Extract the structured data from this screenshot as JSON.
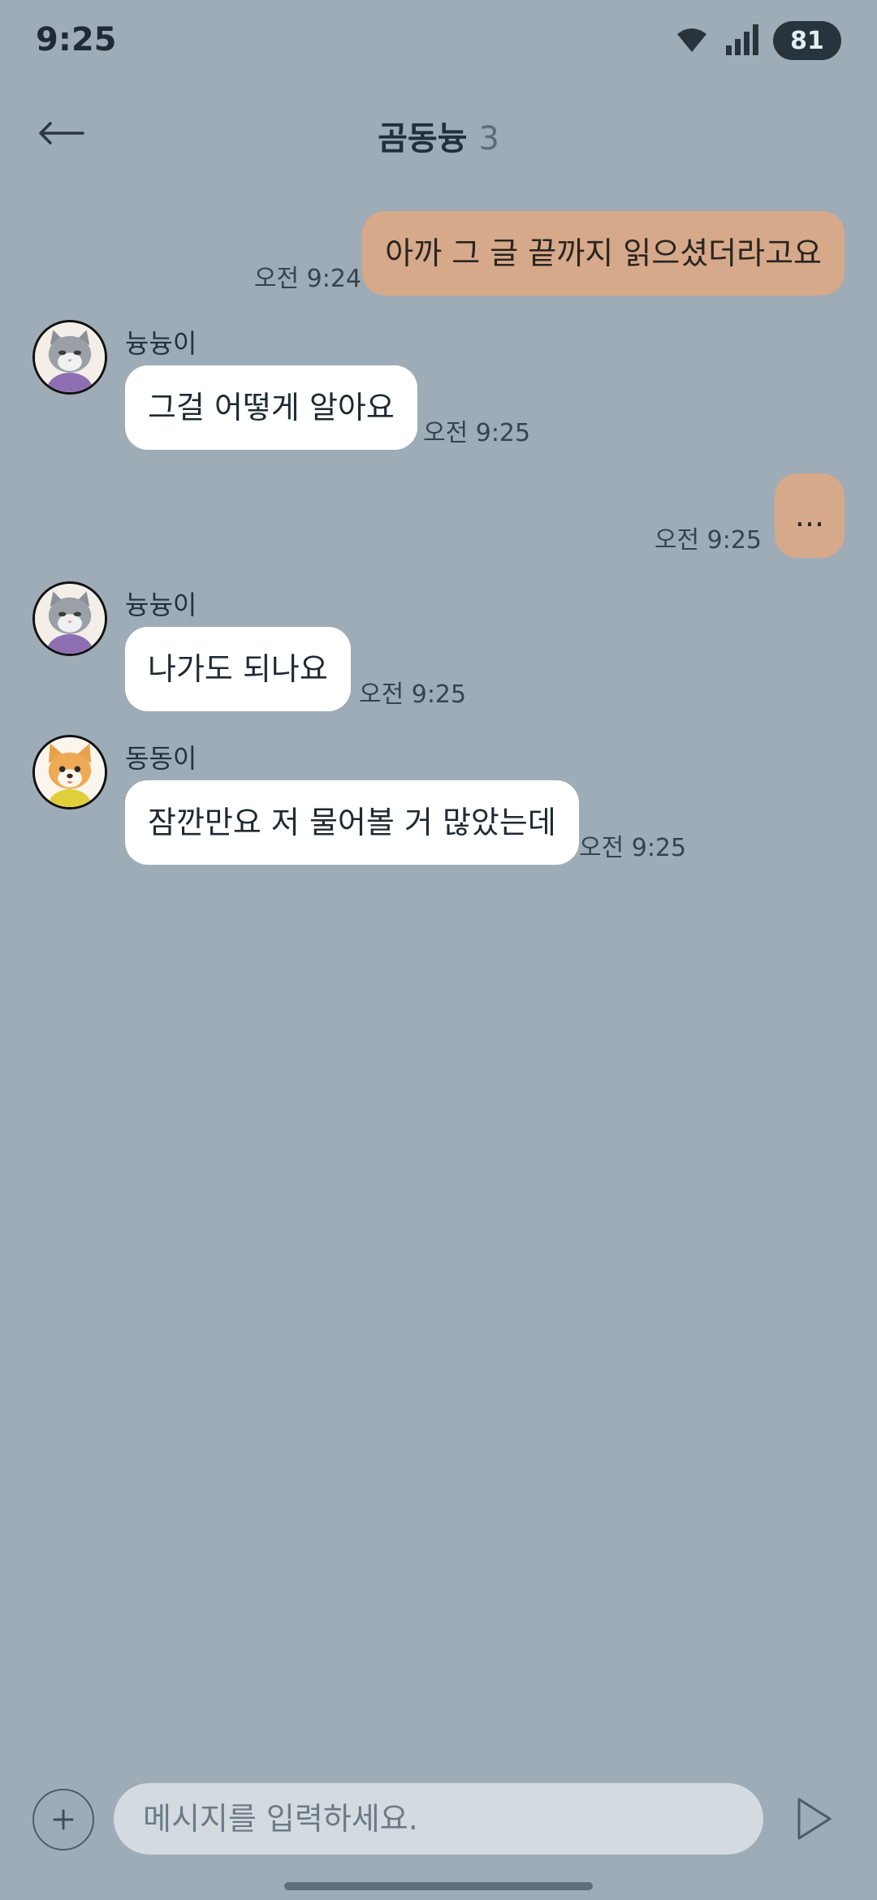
{
  "status_bar": {
    "time": "9:25",
    "battery": "81",
    "wifi_icon": "wifi-icon",
    "signal_icon": "signal-icon"
  },
  "header": {
    "title": "곰동늉",
    "member_count": "3",
    "back_icon": "arrow-left-icon"
  },
  "messages": [
    {
      "side": "mine",
      "text": "아까 그 글 끝까지 읽으셨더라고요",
      "time": "오전 9:24"
    },
    {
      "side": "theirs",
      "sender": "늉늉이",
      "avatar": "cat-avatar",
      "text": "그걸 어떻게 알아요",
      "time": "오전 9:25"
    },
    {
      "side": "mine",
      "text": "...",
      "time": "오전 9:25"
    },
    {
      "side": "theirs",
      "sender": "늉늉이",
      "avatar": "cat-avatar",
      "text": "나가도 되나요",
      "time": "오전 9:25"
    },
    {
      "side": "theirs",
      "sender": "동동이",
      "avatar": "dog-avatar",
      "text": "잠깐만요 저 물어볼 거 많았는데",
      "time": "오전 9:25"
    }
  ],
  "input_bar": {
    "placeholder": "메시지를 입력하세요.",
    "plus_icon": "plus-icon",
    "send_icon": "send-icon"
  },
  "colors": {
    "background": "#9dacb6",
    "my_bubble": "#d6a98a",
    "their_bubble": "#ffffff",
    "input_bg": "#d3dbe1"
  }
}
